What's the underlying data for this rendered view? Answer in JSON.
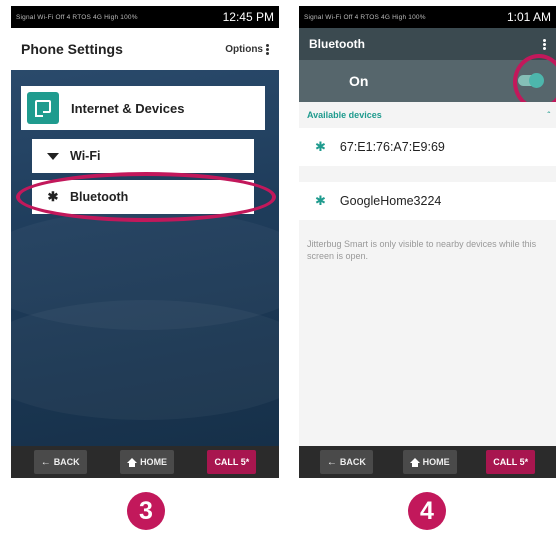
{
  "left_screen": {
    "status": {
      "left": "Signal  Wi-Fi Off  4 RTOS  4G High  100%",
      "time": "12:45 PM"
    },
    "title": "Phone Settings",
    "options": "Options",
    "menu": [
      {
        "label": "Internet & Devices",
        "icon": "cast-icon"
      },
      {
        "label": "Wi-Fi",
        "icon": "wifi-icon"
      },
      {
        "label": "Bluetooth",
        "icon": "bluetooth-icon"
      }
    ],
    "nav": {
      "back": "BACK",
      "home": "HOME",
      "call": "CALL 5*"
    },
    "highlight_color": "#c2185b"
  },
  "right_screen": {
    "status": {
      "left": "Signal  Wi-Fi Off  4 RTOS  4G High  100%",
      "time": "1:01 AM"
    },
    "title": "Bluetooth",
    "toggle_label": "On",
    "toggle_on": true,
    "available_header": "Available devices",
    "devices": [
      "67:E1:76:A7:E9:69",
      "GoogleHome3224"
    ],
    "hint": "Jitterbug Smart is only visible to nearby devices while this screen is open.",
    "nav": {
      "back": "BACK",
      "home": "HOME",
      "call": "CALL 5*"
    },
    "accent_color": "#1f9b8e"
  },
  "steps": [
    "3",
    "4"
  ]
}
